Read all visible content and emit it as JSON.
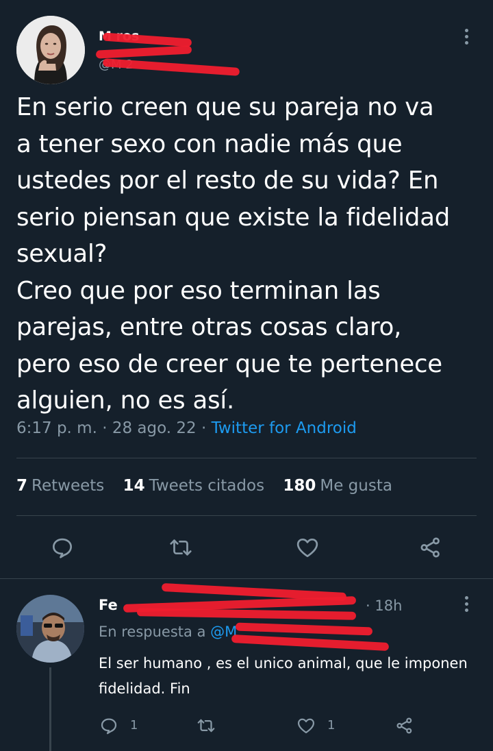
{
  "tweet": {
    "author_name": "M     ros",
    "author_handle": "@M          2",
    "text": "En serio creen que su pareja no va\na tener sexo con nadie más que\nustedes por el resto de su vida? En\nserio piensan que existe la fidelidad\nsexual?\nCreo que por eso terminan las\nparejas, entre otras cosas claro,\npero eso de creer que te pertenece\nalguien, no es así.",
    "time": "6:17 p. m.",
    "date": "28 ago. 22",
    "source": "Twitter for Android",
    "retweets_count": "7",
    "retweets_label": "Retweets",
    "quotes_count": "14",
    "quotes_label": "Tweets citados",
    "likes_count": "180",
    "likes_label": "Me gusta"
  },
  "reply": {
    "author_name": "Fe",
    "time": "18h",
    "in_reply_prefix": "En respuesta a",
    "in_reply_handle": "@M",
    "text": "El ser humano , es el unico animal, que le imponen fidelidad. Fin",
    "reply_count": "1",
    "like_count": "1"
  },
  "icons": [
    "reply-icon",
    "retweet-icon",
    "like-icon",
    "share-icon",
    "more-icon"
  ],
  "colors": {
    "background": "#15202b",
    "secondary_text": "#8899a6",
    "link": "#1d9bf0",
    "divider": "#38444d",
    "redaction": "#f01d2e"
  }
}
